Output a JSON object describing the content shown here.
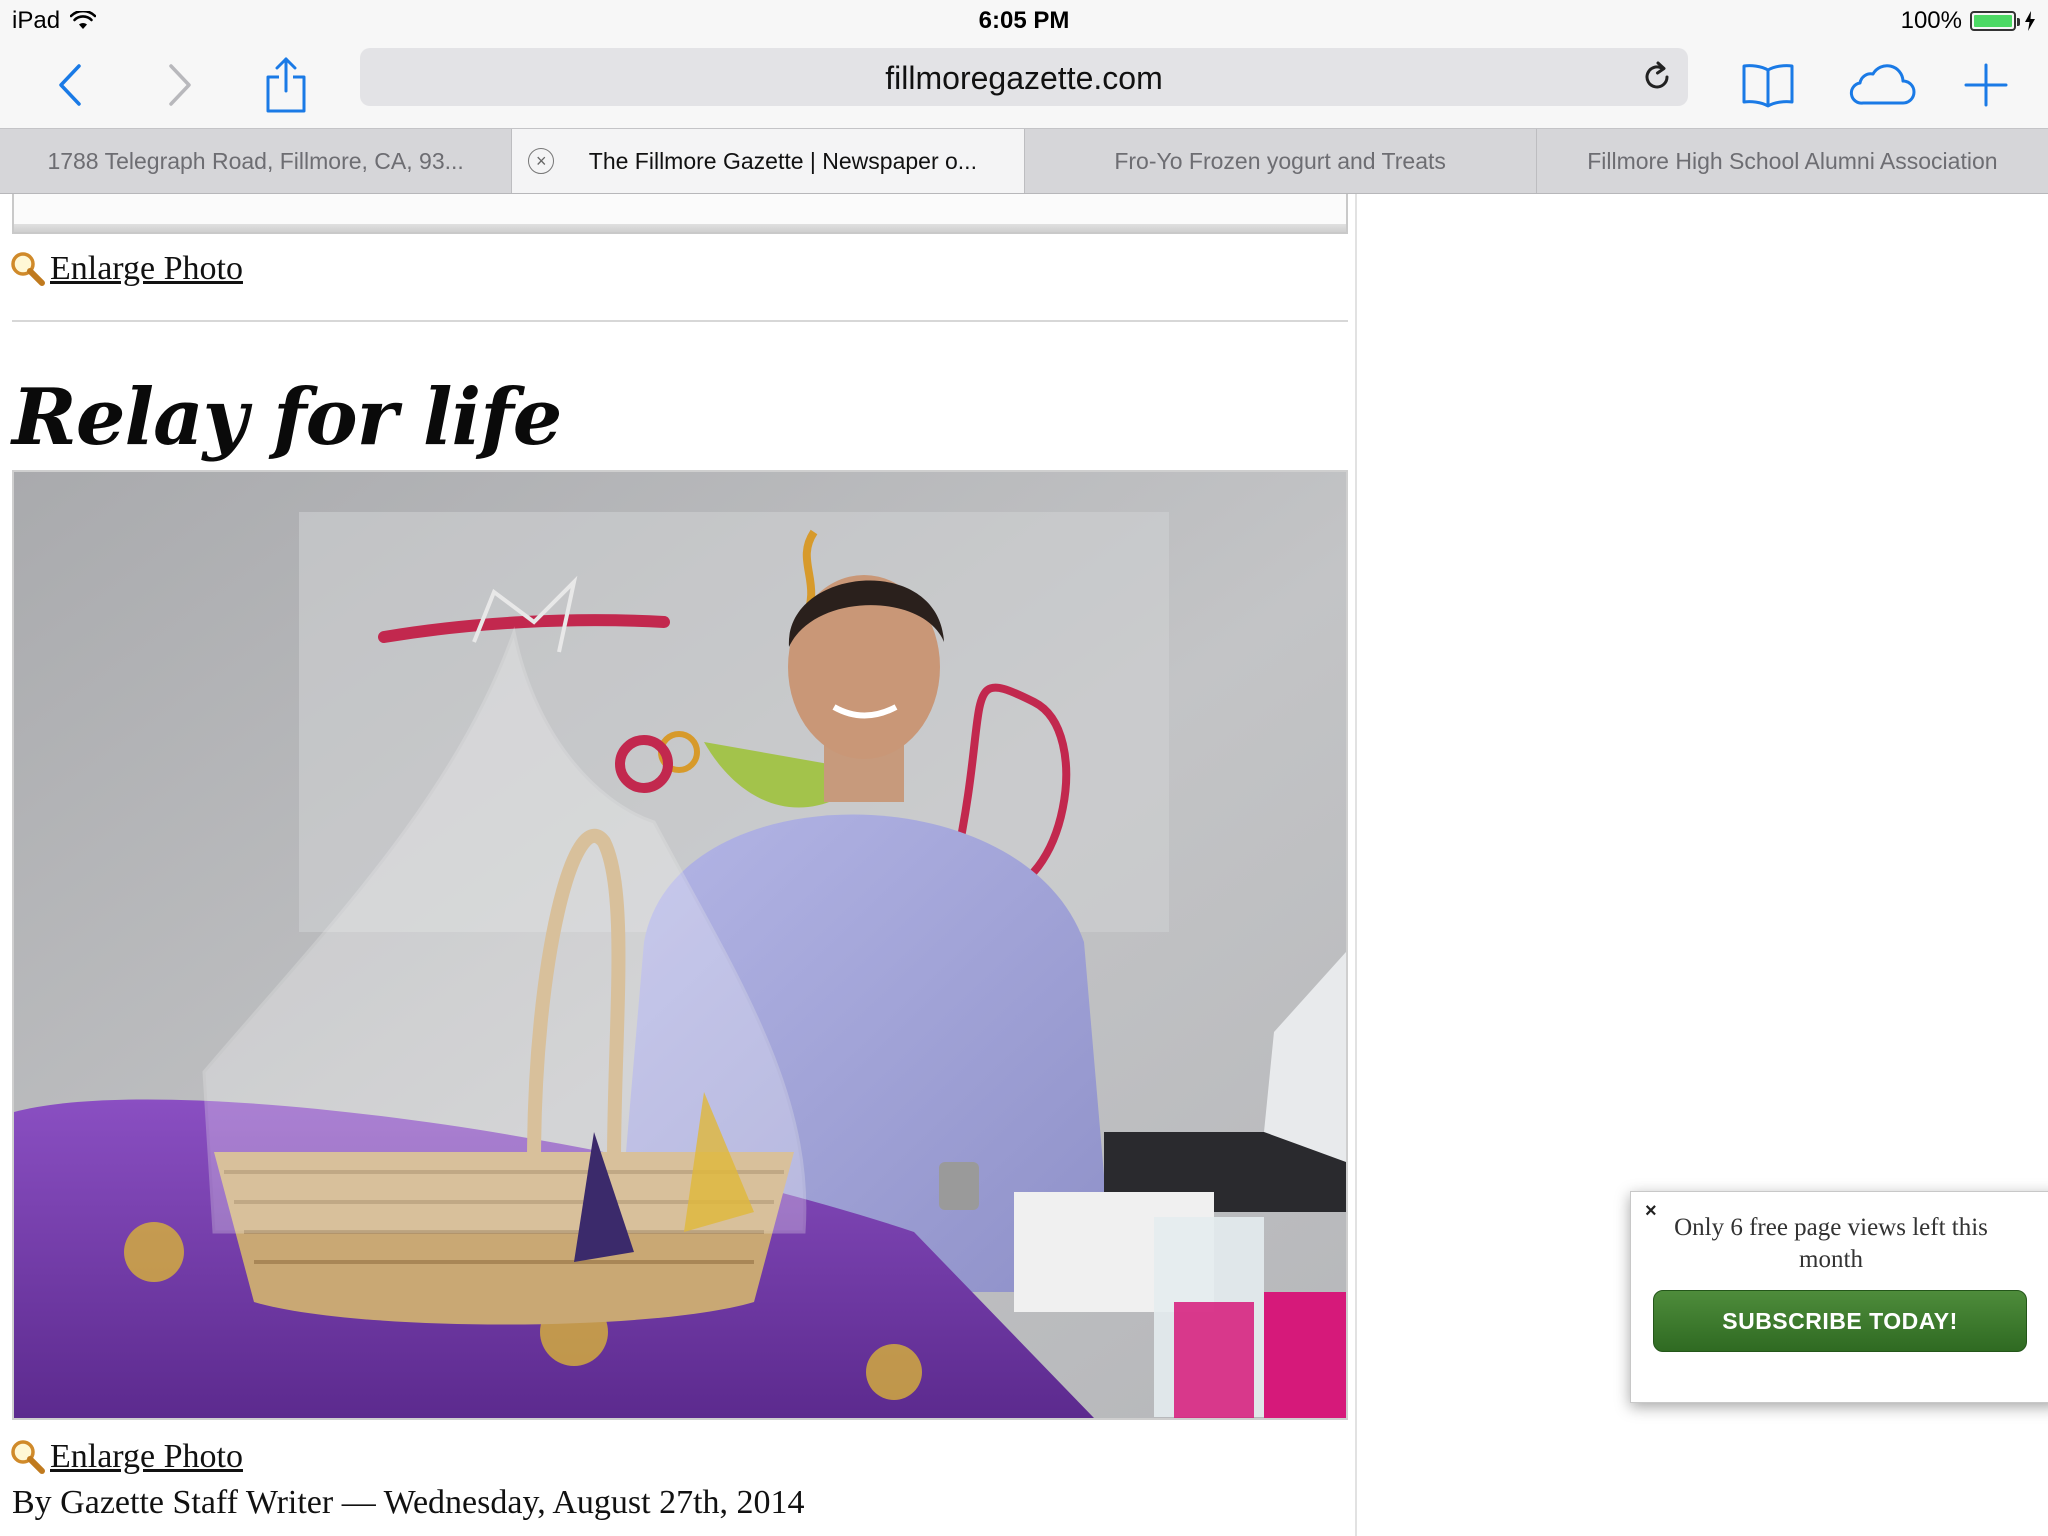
{
  "status_bar": {
    "device": "iPad",
    "time": "6:05 PM",
    "battery": "100%",
    "battery_level": 1.0
  },
  "toolbar": {
    "back_icon": "chevron-left-icon",
    "forward_icon": "chevron-right-icon",
    "share_icon": "share-icon",
    "url": "fillmoregazette.com",
    "reload_icon": "reload-icon",
    "bookmarks_icon": "book-icon",
    "cloud_tabs_icon": "cloud-icon",
    "new_tab_icon": "plus-icon",
    "accent_color": "#1a7ae6"
  },
  "tabs": [
    {
      "label": "1788 Telegraph Road, Fillmore, CA, 93...",
      "active": false
    },
    {
      "label": "The Fillmore Gazette | Newspaper o...",
      "active": true
    },
    {
      "label": "Fro-Yo Frozen yogurt and Treats",
      "active": false
    },
    {
      "label": "Fillmore High School Alumni Association",
      "active": false
    }
  ],
  "article": {
    "enlarge_photo_top": "Enlarge Photo",
    "headline": "Relay for life",
    "enlarge_photo_bottom": "Enlarge Photo",
    "byline": "By Gazette Staff Writer — Wednesday, August 27th, 2014"
  },
  "popup": {
    "close": "×",
    "message": "Only 6 free page views left this month",
    "button": "SUBSCRIBE TODAY!",
    "button_color": "#3b7a2c"
  }
}
